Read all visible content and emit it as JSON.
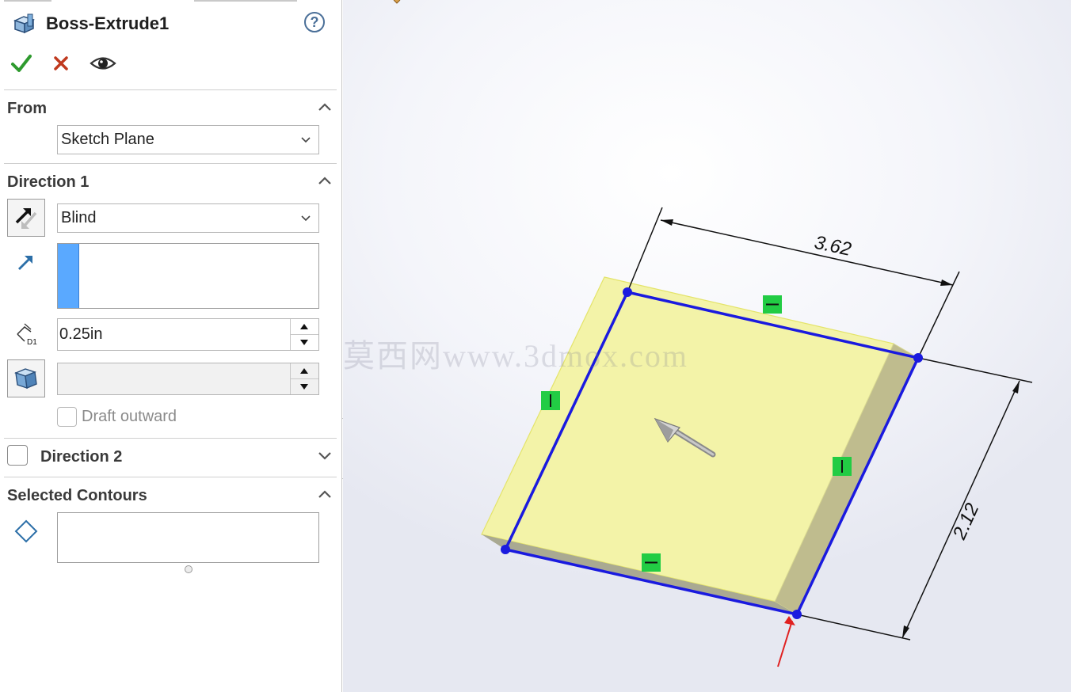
{
  "feature": {
    "title": "Boss-Extrude1",
    "help_icon": "?"
  },
  "actions": {
    "ok": "ok-check-icon",
    "cancel": "cancel-x-icon",
    "preview": "preview-eye-icon"
  },
  "from": {
    "title": "From",
    "value": "Sketch Plane"
  },
  "direction1": {
    "title": "Direction 1",
    "end_condition": "Blind",
    "depth": "0.25in",
    "draft_label": "Draft outward",
    "draft_checked": false
  },
  "direction2": {
    "title": "Direction 2",
    "checked": false
  },
  "selected_contours": {
    "title": "Selected Contours"
  },
  "viewport": {
    "dimension_width": "3.62",
    "dimension_height": "2.12",
    "watermark": "莫西网www.3dmox.com"
  },
  "colors": {
    "accent_blue": "#1a1adf",
    "preview_fill": "#f3f3a8",
    "relation_green": "#22cc44",
    "panel_highlight": "#5aa9ff"
  }
}
